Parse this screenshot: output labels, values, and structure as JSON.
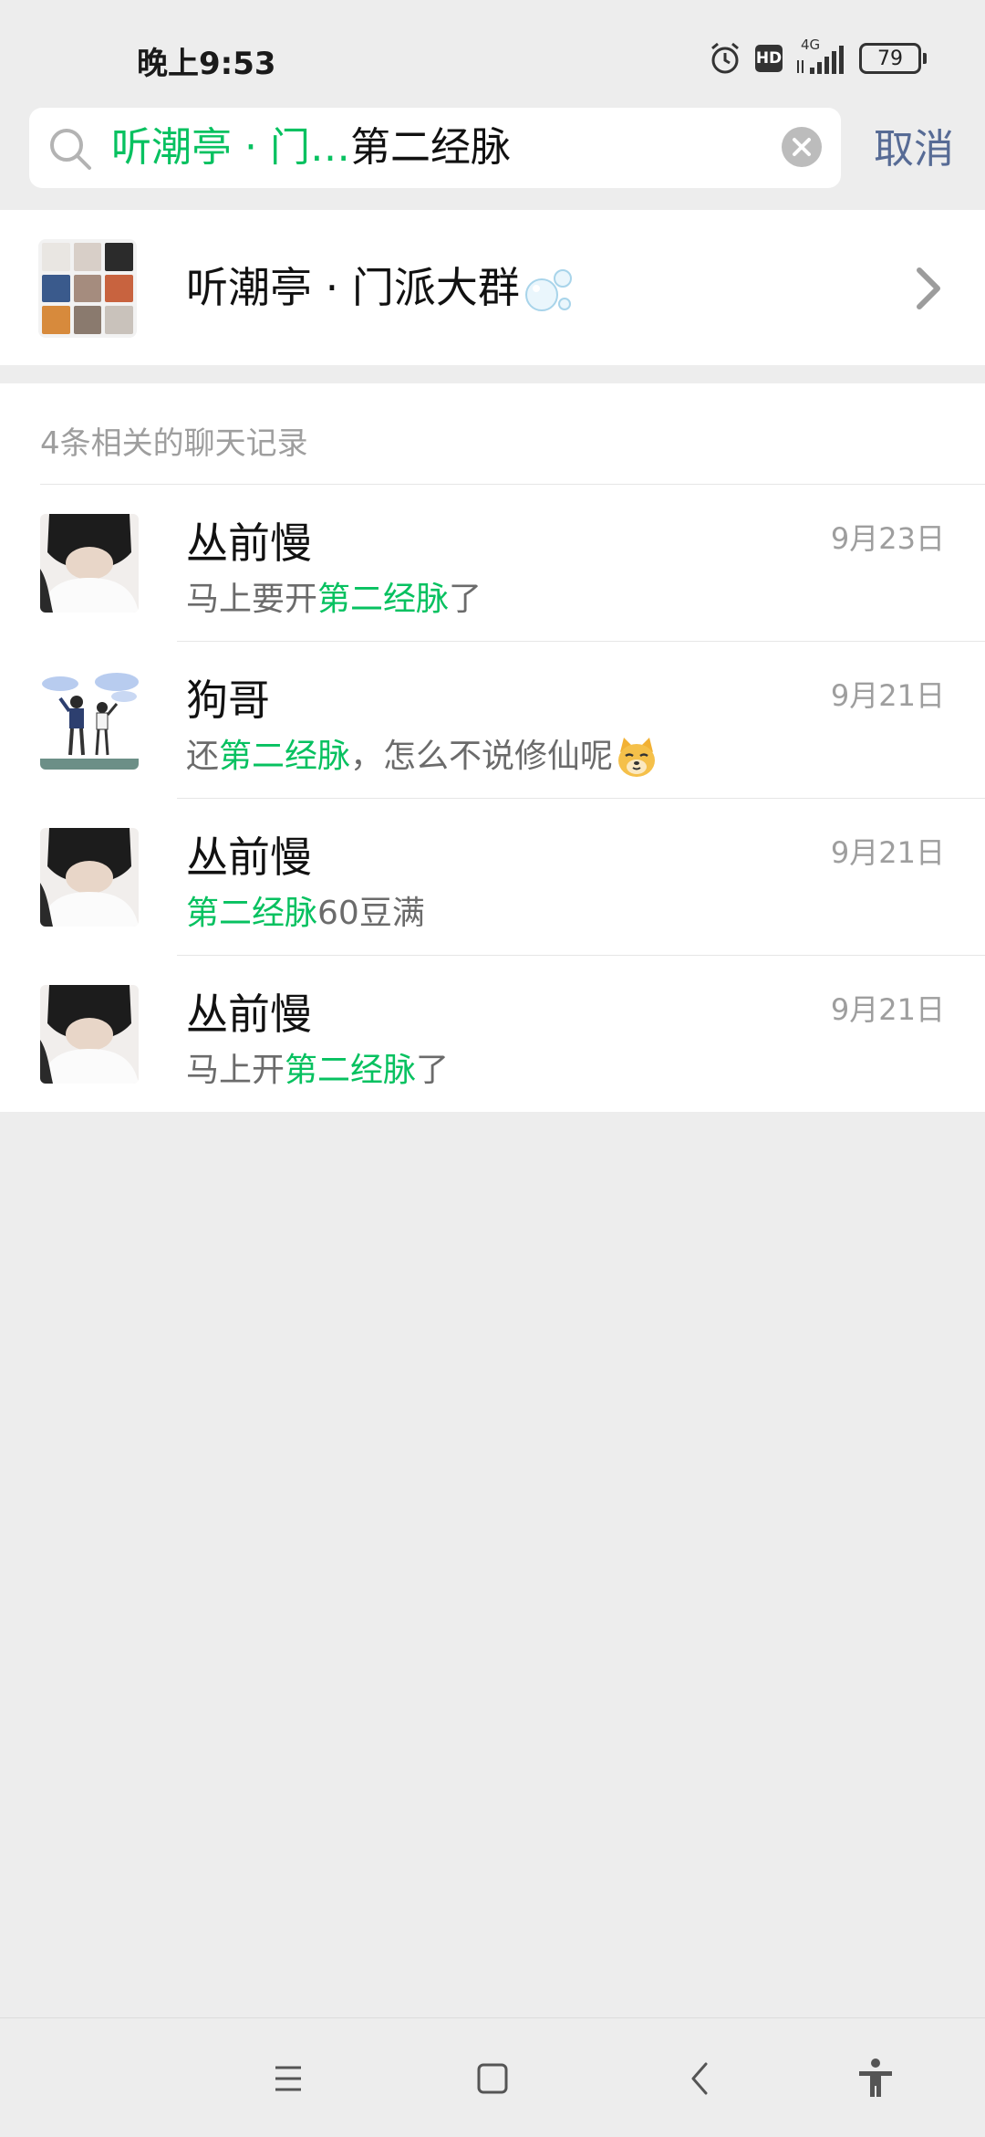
{
  "status_bar": {
    "time": "晚上9:53",
    "hd_label": "HD",
    "network_label": "4G",
    "battery_level": "79"
  },
  "search": {
    "scope_tag": "听潮亭 · 门…",
    "query": "第二经脉",
    "cancel_label": "取消"
  },
  "group_result": {
    "name": "听潮亭 · 门派大群"
  },
  "records": {
    "header": "4条相关的聊天记录",
    "items": [
      {
        "name": "丛前慢",
        "date": "9月23日",
        "msg_before": "马上要开",
        "msg_highlight": "第二经脉",
        "msg_after": "了"
      },
      {
        "name": "狗哥",
        "date": "9月21日",
        "msg_before": "还",
        "msg_highlight": "第二经脉",
        "msg_after": "，怎么不说修仙呢"
      },
      {
        "name": "丛前慢",
        "date": "9月21日",
        "msg_before": "",
        "msg_highlight": "第二经脉",
        "msg_after": "60豆满"
      },
      {
        "name": "丛前慢",
        "date": "9月21日",
        "msg_before": "马上开",
        "msg_highlight": "第二经脉",
        "msg_after": "了"
      }
    ]
  },
  "colors": {
    "highlight": "#07c160",
    "link": "#576b95",
    "background": "#ededed"
  },
  "icons": {
    "search": "search-icon",
    "clear": "clear-icon",
    "chevron": "chevron-right-icon",
    "alarm": "alarm-icon",
    "signal": "signal-icon",
    "battery": "battery-icon",
    "nav_menu": "menu-icon",
    "nav_home": "home-icon",
    "nav_back": "back-icon",
    "nav_accessibility": "accessibility-icon"
  }
}
